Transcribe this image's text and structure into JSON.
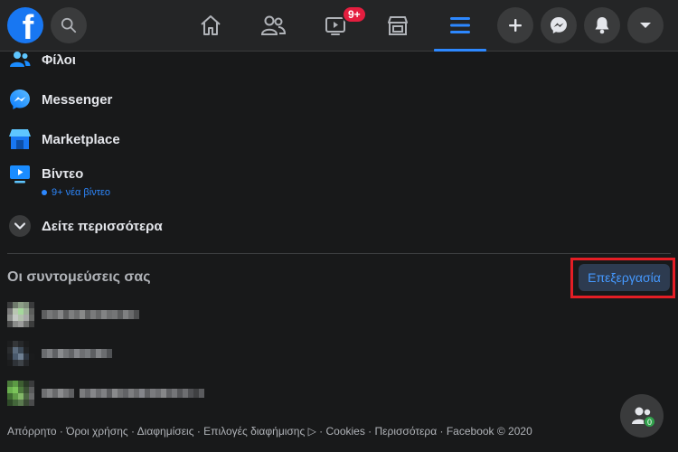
{
  "topbar": {
    "logo_letter": "f",
    "notifications_badge": "9+",
    "nav": [
      "home-icon",
      "friends-icon",
      "watch-icon",
      "marketplace-icon",
      "menu-icon"
    ],
    "actions": [
      "plus-icon",
      "messenger-icon",
      "bell-icon",
      "caret-down-icon"
    ]
  },
  "menu": {
    "friends": "Φίλοι",
    "messenger": "Messenger",
    "marketplace": "Marketplace",
    "video": "Βίντεο",
    "video_sub": "9+ νέα βίντεο",
    "see_more": "Δείτε περισσότερα"
  },
  "shortcuts": {
    "title": "Οι συντομεύσεις σας",
    "edit_label": "Επεξεργασία"
  },
  "footer": {
    "text": "Απόρρητο · Όροι χρήσης · Διαφημίσεις · Επιλογές διαφήμισης ▷ · Cookies · Περισσότερα · Facebook © 2020"
  },
  "fab": {
    "badge": "0"
  },
  "colors": {
    "accent": "#2d88ff",
    "highlight": "#e41e25",
    "background": "#18191a"
  }
}
